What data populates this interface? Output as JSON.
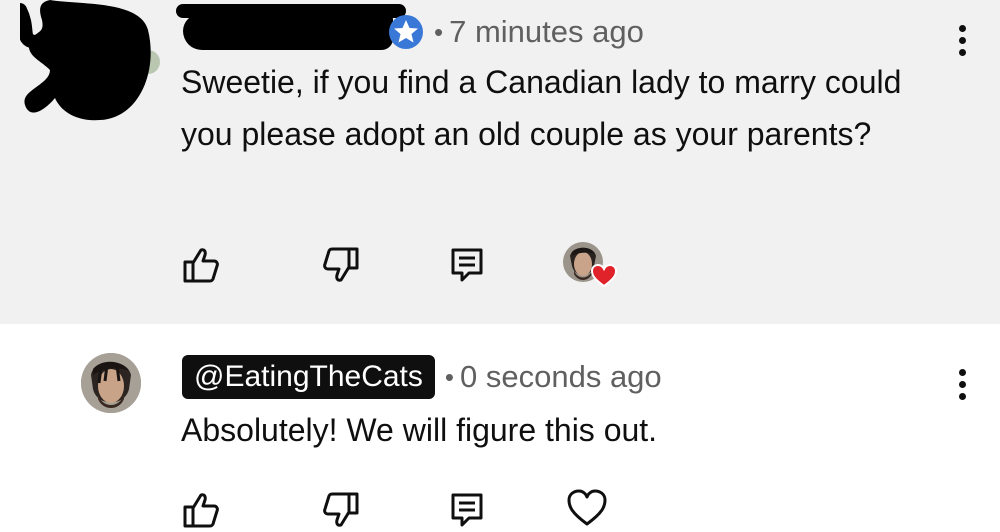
{
  "comments": [
    {
      "author_handle": "",
      "verified": true,
      "timestamp": "7 minutes ago",
      "separator": "•",
      "text": "Sweetie, if you find a Canadian lady to marry could you please adopt an old couple as your parents?",
      "creator_hearted": true
    },
    {
      "author_handle": "@EatingTheCats",
      "timestamp": "0 seconds ago",
      "separator": "•",
      "text": "Absolutely! We will figure this out.",
      "creator_hearted": false
    }
  ],
  "icons": {
    "like": "thumb-up-icon",
    "dislike": "thumb-down-icon",
    "reply": "reply-icon",
    "heart": "heart-icon",
    "more": "more-vert-icon",
    "verified": "verified-star-badge-icon"
  },
  "colors": {
    "verified_badge": "#3a78d8",
    "heart": "#e0222b",
    "highlight_bg": "#f1f1f1"
  }
}
